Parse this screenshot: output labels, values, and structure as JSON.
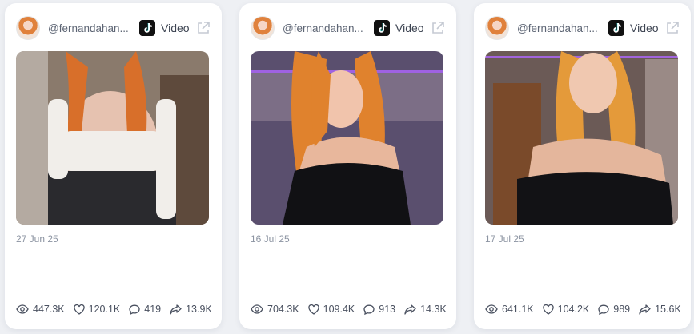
{
  "cards": [
    {
      "handle": "@fernandahan...",
      "platform_icon": "tiktok-icon",
      "type_label": "Video",
      "date": "27 Jun 25",
      "stats": {
        "views": "447.3K",
        "likes": "120.1K",
        "comments": "419",
        "shares": "13.9K"
      },
      "colors": {
        "bg": "#8a7a6c",
        "hair": "#d86f2a",
        "outfit": "#f1eeea",
        "lower": "#2a2a2e"
      }
    },
    {
      "handle": "@fernandahan...",
      "platform_icon": "tiktok-icon",
      "type_label": "Video",
      "date": "16 Jul 25",
      "stats": {
        "views": "704.3K",
        "likes": "109.4K",
        "comments": "913",
        "shares": "14.3K"
      },
      "colors": {
        "bg": "#5a4f6e",
        "hair": "#e0822d",
        "outfit": "#111114",
        "lower": "#111114"
      }
    },
    {
      "handle": "@fernandahan...",
      "platform_icon": "tiktok-icon",
      "type_label": "Video",
      "date": "17 Jul 25",
      "stats": {
        "views": "641.1K",
        "likes": "104.2K",
        "comments": "989",
        "shares": "15.6K"
      },
      "colors": {
        "bg": "#6b5a56",
        "hair": "#e49a3a",
        "outfit": "#121215",
        "lower": "#121215"
      }
    }
  ]
}
